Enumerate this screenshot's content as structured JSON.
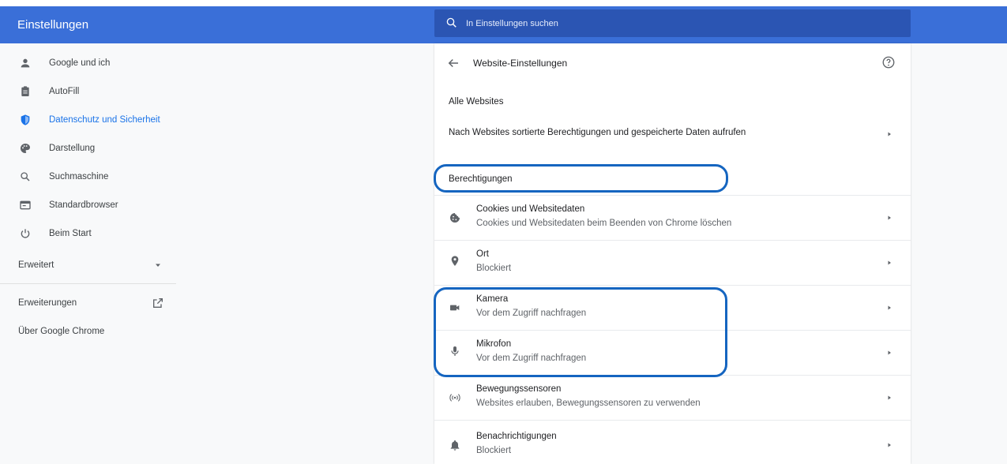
{
  "header": {
    "title": "Einstellungen",
    "search_placeholder": "In Einstellungen suchen"
  },
  "sidebar": {
    "items": [
      {
        "label": "Google und ich",
        "icon": "person-icon"
      },
      {
        "label": "AutoFill",
        "icon": "clipboard-icon"
      },
      {
        "label": "Datenschutz und Sicherheit",
        "icon": "shield-icon"
      },
      {
        "label": "Darstellung",
        "icon": "palette-icon"
      },
      {
        "label": "Suchmaschine",
        "icon": "search-icon"
      },
      {
        "label": "Standardbrowser",
        "icon": "browser-window-icon"
      },
      {
        "label": "Beim Start",
        "icon": "power-icon"
      }
    ],
    "advanced_label": "Erweitert",
    "extensions_label": "Erweiterungen",
    "about_label": "Über Google Chrome"
  },
  "content": {
    "title": "Website-Einstellungen",
    "all_sites_heading": "Alle Websites",
    "all_sites_row": "Nach Websites sortierte Berechtigungen und gespeicherte Daten aufrufen",
    "permissions_heading": "Berechtigungen",
    "rows": [
      {
        "title": "Cookies und Websitedaten",
        "subtitle": "Cookies und Websitedaten beim Beenden von Chrome löschen",
        "icon": "cookie-icon"
      },
      {
        "title": "Ort",
        "subtitle": "Blockiert",
        "icon": "location-pin-icon"
      },
      {
        "title": "Kamera",
        "subtitle": "Vor dem Zugriff nachfragen",
        "icon": "camera-icon"
      },
      {
        "title": "Mikrofon",
        "subtitle": "Vor dem Zugriff nachfragen",
        "icon": "microphone-icon"
      },
      {
        "title": "Bewegungssensoren",
        "subtitle": "Websites erlauben, Bewegungssensoren zu verwenden",
        "icon": "motion-sensor-icon"
      },
      {
        "title": "Benachrichtigungen",
        "subtitle": "Blockiert",
        "icon": "bell-icon"
      }
    ]
  },
  "colors": {
    "header": "#3a6fd8",
    "search_box": "#2b55b3",
    "active_nav": "#1a73e8",
    "highlight": "#1565c0"
  }
}
